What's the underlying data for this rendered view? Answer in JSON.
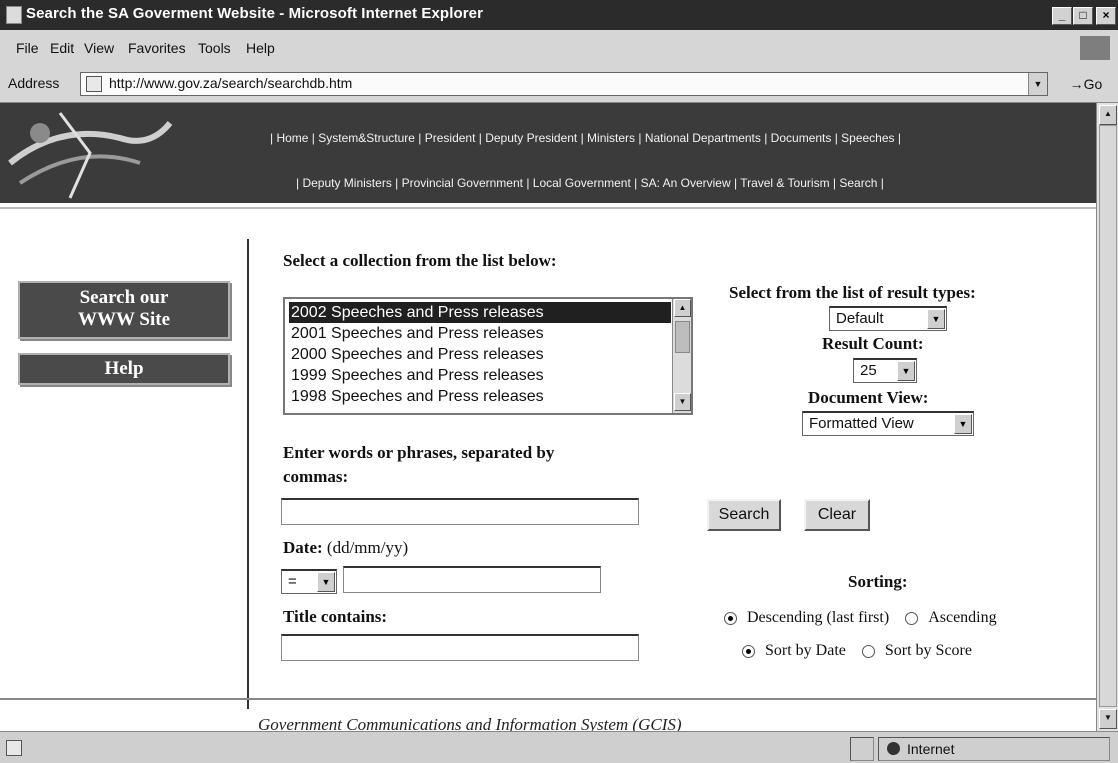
{
  "window": {
    "title": "Search the SA Goverment Website - Microsoft Internet Explorer",
    "controls": {
      "minimize": "_",
      "maximize": "□",
      "close": "×"
    }
  },
  "menu": [
    "File",
    "Edit",
    "View",
    "Favorites",
    "Tools",
    "Help"
  ],
  "address": {
    "label": "Address",
    "url": "http://www.gov.za/search/searchdb.htm",
    "go": "→Go"
  },
  "nav": {
    "line1": "| Home | System&Structure | President | Deputy President | Ministers | National Departments | Documents | Speeches |",
    "line2": "| Deputy Ministers | Provincial Government | Local Government | SA: An Overview | Travel & Tourism | Search |"
  },
  "sidebar": {
    "search_button": [
      "Search our",
      "WWW Site"
    ],
    "help_button": "Help"
  },
  "form": {
    "collection_label": "Select a collection from the list below:",
    "collections": [
      "2002 Speeches and Press releases",
      "2001 Speeches and Press releases",
      "2000 Speeches and Press releases",
      "1999 Speeches and Press releases",
      "1998 Speeches and Press releases"
    ],
    "selected_collection": "2002 Speeches and Press releases",
    "words_label": [
      "Enter words or phrases, separated by",
      "commas:"
    ],
    "words_value": "",
    "date_label": "Date:",
    "date_hint": "(dd/mm/yy)",
    "date_operator": "=",
    "date_value": "",
    "title_label": "Title contains:",
    "title_value": "",
    "result_types_label": "Select from the list of result types:",
    "result_type": "Default",
    "result_count_label": "Result Count:",
    "result_count": "25",
    "doc_view_label": "Document View:",
    "doc_view": "Formatted View",
    "search_button": "Search",
    "clear_button": "Clear",
    "sorting_label": "Sorting:",
    "order_options": [
      "Descending (last first)",
      "Ascending"
    ],
    "order_selected": "Descending (last first)",
    "sortby_options": [
      "Sort by Date",
      "Sort by Score"
    ],
    "sortby_selected": "Sort by Date"
  },
  "footer": {
    "text": "Government Communications and Information System (GCIS)"
  },
  "status": {
    "zone": "Internet"
  },
  "colors": {
    "banner": "#3b3b3b",
    "sidebar_button": "#4a4a4a",
    "titlebar": "#2b2b2b",
    "selection": "#202020"
  }
}
